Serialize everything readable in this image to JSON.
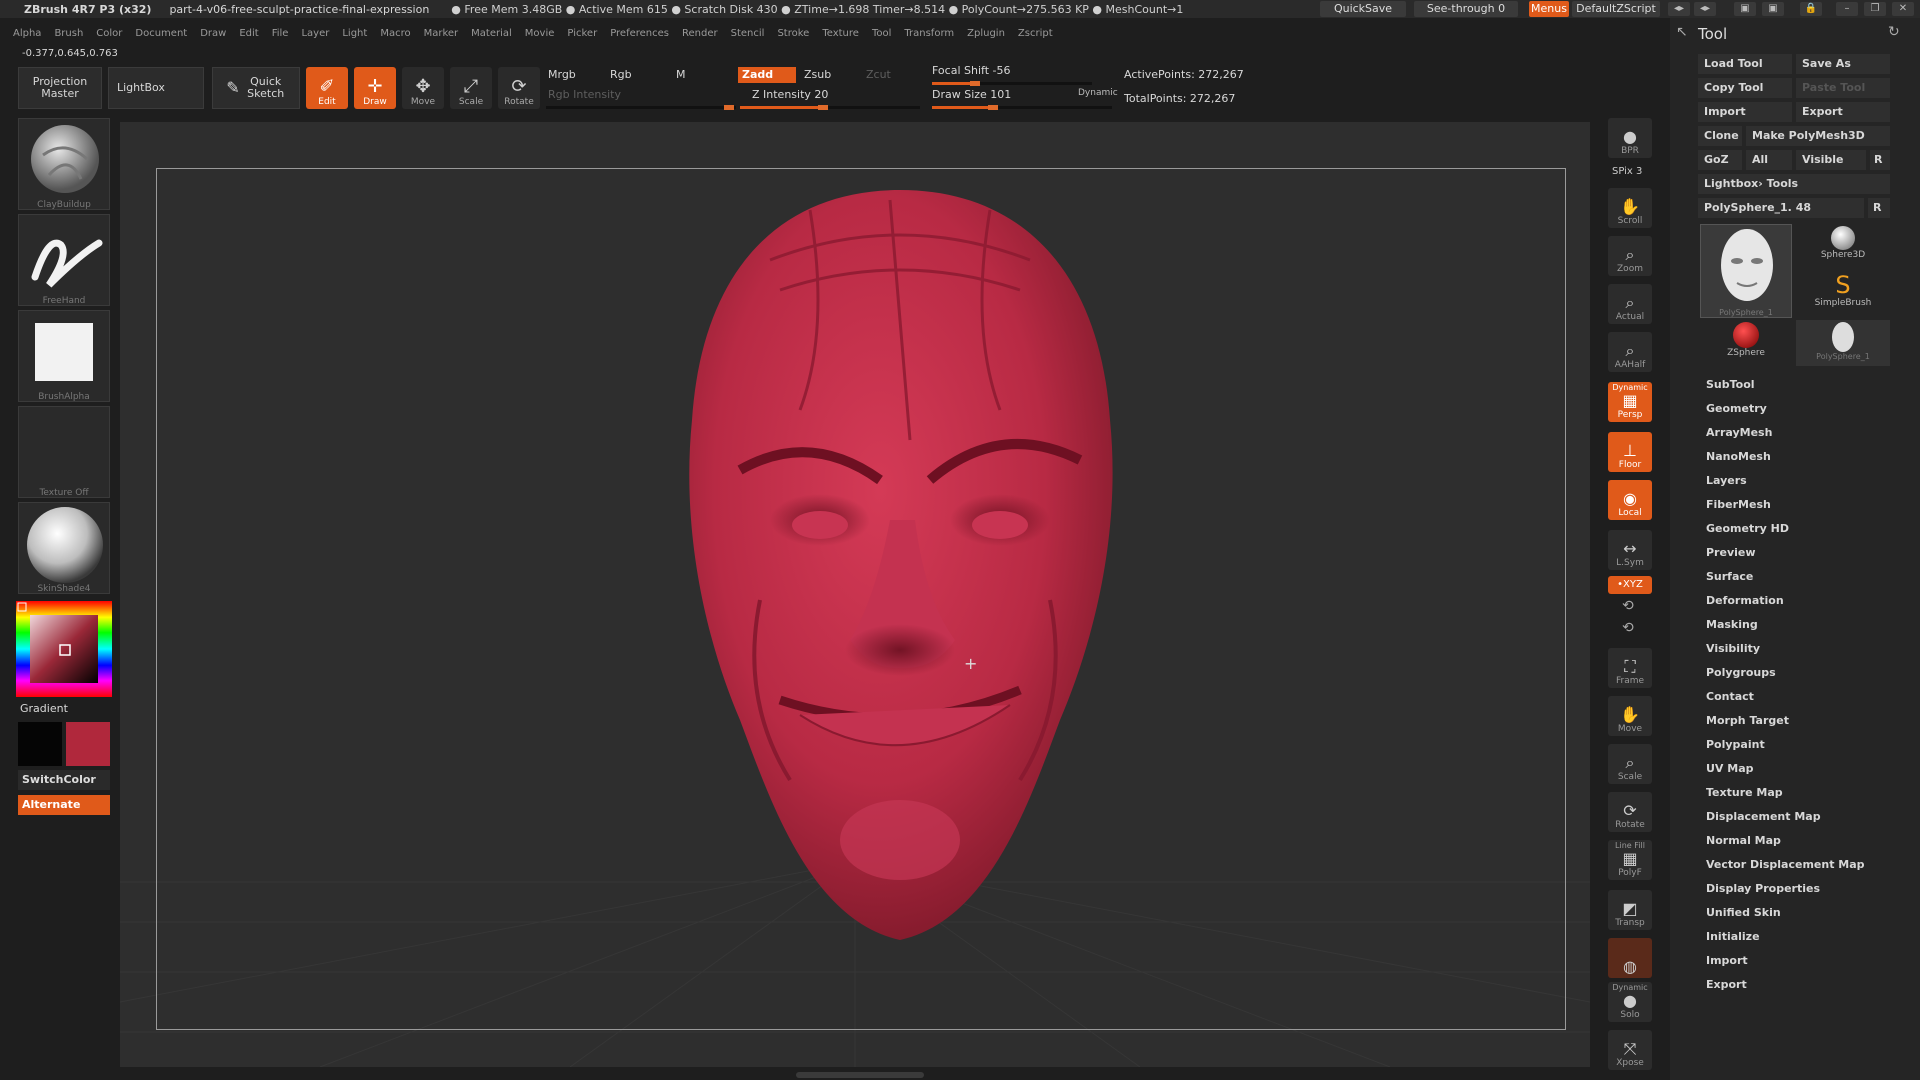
{
  "titlebar": {
    "app": "ZBrush 4R7 P3 (x32)",
    "project": "part-4-v06-free-sculpt-practice-final-expression",
    "stats": "● Free Mem 3.48GB ● Active Mem 615 ● Scratch Disk 430 ● ZTime→1.698 Timer→8.514 ● PolyCount→275.563 KP ● MeshCount→1",
    "quicksave": "QuickSave",
    "seethrough": "See-through  0",
    "menus": "Menus",
    "script": "DefaultZScript"
  },
  "menubar": [
    "Alpha",
    "Brush",
    "Color",
    "Document",
    "Draw",
    "Edit",
    "File",
    "Layer",
    "Light",
    "Macro",
    "Marker",
    "Material",
    "Movie",
    "Picker",
    "Preferences",
    "Render",
    "Stencil",
    "Stroke",
    "Texture",
    "Tool",
    "Transform",
    "Zplugin",
    "Zscript"
  ],
  "coords": "-0.377,0.645,0.763",
  "shelf": {
    "projection_master": "Projection Master",
    "lightbox": "LightBox",
    "quick_sketch": "Quick Sketch",
    "edit": "Edit",
    "draw": "Draw",
    "move": "Move",
    "scale": "Scale",
    "rotate": "Rotate",
    "mrgb": "Mrgb",
    "rgb": "Rgb",
    "m": "M",
    "rgb_intensity": "Rgb Intensity",
    "zadd": "Zadd",
    "zsub": "Zsub",
    "zcut": "Zcut",
    "z_intensity": "Z Intensity 20",
    "focal_shift": "Focal Shift -56",
    "draw_size": "Draw Size 101",
    "dynamic": "Dynamic",
    "active_points": "ActivePoints: 272,267",
    "total_points": "TotalPoints: 272,267"
  },
  "left_tray": {
    "brush": "ClayBuildup",
    "stroke": "FreeHand",
    "alpha": "BrushAlpha",
    "texture": "Texture Off",
    "material": "SkinShade4",
    "gradient": "Gradient",
    "switch_color": "SwitchColor",
    "alternate": "Alternate",
    "colors": {
      "main": "#b0283c",
      "secondary": "#000000",
      "accent": "#e05a1a"
    }
  },
  "right_strip": {
    "bpr": "BPR",
    "spix": "SPix 3",
    "scroll": "Scroll",
    "zoom": "Zoom",
    "actual": "Actual",
    "aahalf": "AAHalf",
    "dynamic": "Dynamic",
    "persp": "Persp",
    "floor": "Floor",
    "local": "Local",
    "lsym": "L.Sym",
    "xyz": "•XYZ",
    "frame": "Frame",
    "move": "Move",
    "scale": "Scale",
    "rotate": "Rotate",
    "line_fill": "Line Fill",
    "polyf": "PolyF",
    "transp": "Transp",
    "dynamic2": "Dynamic",
    "solo": "Solo",
    "xpose": "Xpose"
  },
  "tool_panel": {
    "title": "Tool",
    "load_tool": "Load Tool",
    "save_as": "Save As",
    "copy_tool": "Copy Tool",
    "paste_tool": "Paste Tool",
    "import": "Import",
    "export": "Export",
    "clone": "Clone",
    "make_polymesh": "Make PolyMesh3D",
    "goz": "GoZ",
    "all": "All",
    "visible": "Visible",
    "r": "R",
    "lightbox_tools": "Lightbox› Tools",
    "current_tool": "PolySphere_1. 48",
    "thumbs": [
      "PolySphere_1",
      "Sphere3D",
      "SimpleBrush",
      "ZSphere",
      "PolySphere_1"
    ],
    "subpalettes": [
      "SubTool",
      "Geometry",
      "ArrayMesh",
      "NanoMesh",
      "Layers",
      "FiberMesh",
      "Geometry HD",
      "Preview",
      "Surface",
      "Deformation",
      "Masking",
      "Visibility",
      "Polygroups",
      "Contact",
      "Morph Target",
      "Polypaint",
      "UV Map",
      "Texture Map",
      "Displacement Map",
      "Normal Map",
      "Vector Displacement Map",
      "Display Properties",
      "Unified Skin",
      "Initialize",
      "Import",
      "Export"
    ]
  }
}
